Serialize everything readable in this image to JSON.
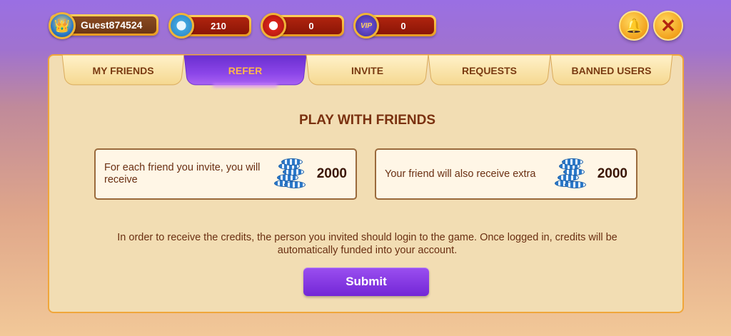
{
  "topbar": {
    "username": "Guest874524",
    "balances": [
      {
        "icon": "blue-chip-icon",
        "value": "210"
      },
      {
        "icon": "poker-chip-icon",
        "value": "0"
      },
      {
        "icon": "vip-icon",
        "value": "0",
        "icon_text": "VIP"
      }
    ],
    "bell_icon": "🔔",
    "close_icon": "✕"
  },
  "tabs": [
    {
      "label": "MY FRIENDS"
    },
    {
      "label": "REFER",
      "active": true
    },
    {
      "label": "INVITE"
    },
    {
      "label": "REQUESTS"
    },
    {
      "label": "BANNED USERS"
    }
  ],
  "refer": {
    "heading": "PLAY WITH FRIENDS",
    "cards": [
      {
        "text": "For each friend you invite, you will receive",
        "amount": "2000"
      },
      {
        "text": "Your friend will also receive extra",
        "amount": "2000"
      }
    ],
    "note": "In order to receive the credits, the person you invited should login to the game. Once logged in, credits will be automatically funded into your account.",
    "submit_label": "Submit"
  },
  "colors": {
    "accent_purple": "#7a2fe0",
    "panel_bg": "#f2ddb3",
    "text_brown": "#6a2f12"
  }
}
